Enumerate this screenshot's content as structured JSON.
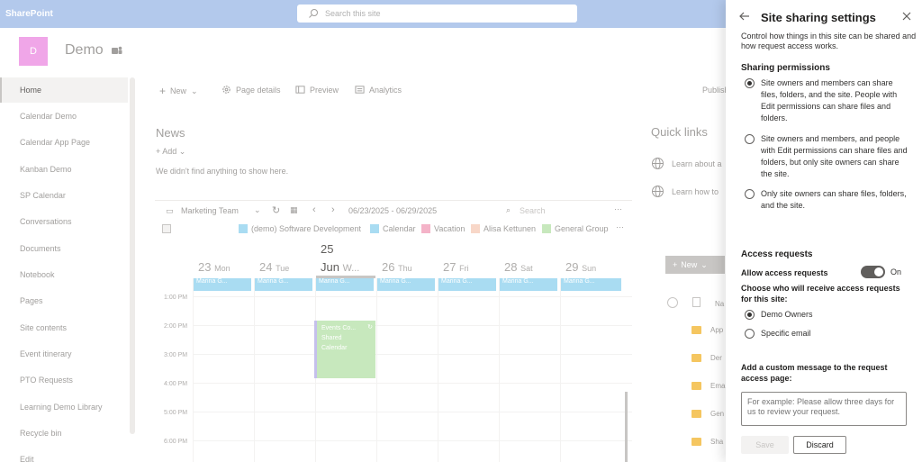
{
  "topbar": {
    "brand": "SharePoint",
    "search_placeholder": "Search this site"
  },
  "site": {
    "logo_letter": "D",
    "title": "Demo"
  },
  "leftnav": {
    "items": [
      {
        "label": "Home",
        "active": true
      },
      {
        "label": "Calendar Demo"
      },
      {
        "label": "Calendar App Page"
      },
      {
        "label": "Kanban Demo"
      },
      {
        "label": "SP Calendar"
      },
      {
        "label": "Conversations"
      },
      {
        "label": "Documents"
      },
      {
        "label": "Notebook"
      },
      {
        "label": "Pages"
      },
      {
        "label": "Site contents"
      },
      {
        "label": "Event itinerary"
      },
      {
        "label": "PTO Requests"
      },
      {
        "label": "Learning Demo Library"
      },
      {
        "label": "Recycle bin"
      },
      {
        "label": "Edit"
      }
    ]
  },
  "commandbar": {
    "new": "New",
    "page_details": "Page details",
    "preview": "Preview",
    "analytics": "Analytics",
    "publish": "Publish"
  },
  "news": {
    "title": "News",
    "add": "Add",
    "empty": "We didn't find anything to show here."
  },
  "calendar": {
    "team": "Marketing Team",
    "date_range": "06/23/2025 - 06/29/2025",
    "search_placeholder": "Search",
    "legend": [
      {
        "label": "(demo) Software Development",
        "color": "#a9dcf2"
      },
      {
        "label": "Calendar",
        "color": "#a9dcf2"
      },
      {
        "label": "Vacation",
        "color": "#f4b3c8"
      },
      {
        "label": "Alisa Kettunen",
        "color": "#f8d7c8"
      },
      {
        "label": "General Group",
        "color": "#c7e8bd"
      }
    ],
    "days": [
      {
        "num": "23",
        "name": "Mon"
      },
      {
        "num": "24",
        "name": "Tue"
      },
      {
        "num": "25",
        "month": "Jun",
        "name": "W..."
      },
      {
        "num": "26",
        "name": "Thu"
      },
      {
        "num": "27",
        "name": "Fri"
      },
      {
        "num": "28",
        "name": "Sat"
      },
      {
        "num": "29",
        "name": "Sun"
      }
    ],
    "allday_label": "Marina G...",
    "hours": [
      "1:00 PM",
      "2:00 PM",
      "3:00 PM",
      "4:00 PM",
      "5:00 PM",
      "6:00 PM"
    ],
    "event": {
      "line1": "Events Co...",
      "line2": "Shared",
      "line3": "Calendar"
    }
  },
  "quicklinks": {
    "title": "Quick links",
    "items": [
      "Learn about a",
      "Learn how to"
    ]
  },
  "documents": {
    "new": "New",
    "col_name": "Na",
    "rows": [
      "App",
      "Der",
      "Ema",
      "Gen",
      "Sha"
    ]
  },
  "panel": {
    "title": "Site sharing settings",
    "description": "Control how things in this site can be shared and how request access works.",
    "sharing_heading": "Sharing permissions",
    "sharing_options": [
      {
        "label": "Site owners and members can share files, folders, and the site. People with Edit permissions can share files and folders.",
        "checked": true
      },
      {
        "label": "Site owners and members, and people with Edit permissions can share files and folders, but only site owners can share the site.",
        "checked": false
      },
      {
        "label": "Only site owners can share files, folders, and the site.",
        "checked": false
      }
    ],
    "access_heading": "Access requests",
    "allow_label": "Allow access requests",
    "toggle_state": "On",
    "choose_label": "Choose who will receive access requests for this site:",
    "receivers": [
      {
        "label": "Demo Owners",
        "checked": true
      },
      {
        "label": "Specific email",
        "checked": false
      }
    ],
    "custom_msg_label": "Add a custom message to the request access page:",
    "custom_msg_placeholder": "For example: Please allow three days for us to review your request.",
    "save": "Save",
    "discard": "Discard"
  }
}
